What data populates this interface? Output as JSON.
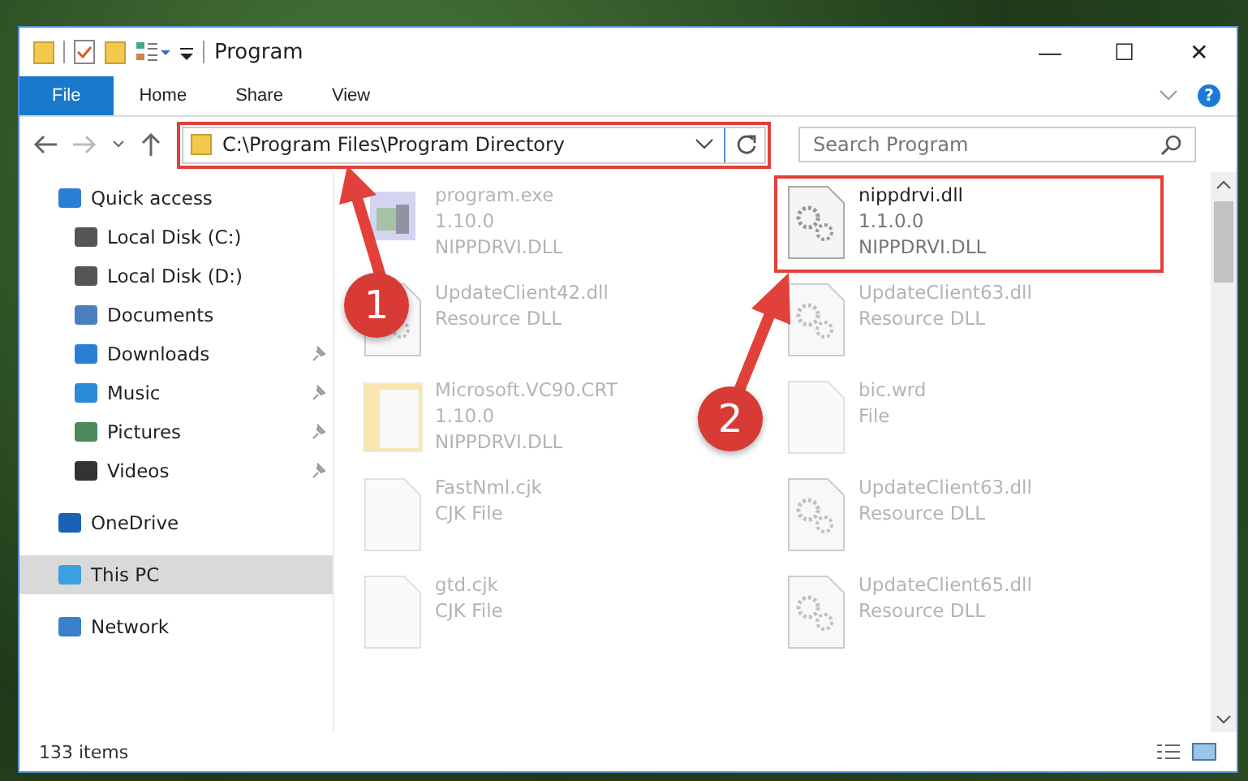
{
  "window": {
    "title": "Program",
    "controls": [
      "—",
      "☐",
      "✕"
    ]
  },
  "ribbon": {
    "tabs": [
      {
        "label": "File",
        "selected": true
      },
      {
        "label": "Home",
        "selected": false
      },
      {
        "label": "Share",
        "selected": false
      },
      {
        "label": "View",
        "selected": false
      }
    ],
    "help": "?"
  },
  "address_bar": {
    "path": "C:\\Program Files\\Program Directory",
    "highlighted": true
  },
  "search": {
    "placeholder": "Search Program"
  },
  "sidebar": {
    "items": [
      {
        "label": "Quick access",
        "pinned": false,
        "selected": false,
        "children": [
          {
            "label": "Local Disk (C:)",
            "pinned": false,
            "selected": false
          },
          {
            "label": "Local Disk (D:)",
            "pinned": false,
            "selected": false
          },
          {
            "label": "Documents",
            "pinned": false,
            "selected": false
          },
          {
            "label": "Downloads",
            "pinned": true,
            "selected": false
          },
          {
            "label": "Music",
            "pinned": true,
            "selected": false
          },
          {
            "label": "Pictures",
            "pinned": true,
            "selected": false
          },
          {
            "label": "Videos",
            "pinned": true,
            "selected": false
          }
        ]
      },
      {
        "label": "OneDrive",
        "pinned": false,
        "selected": false
      },
      {
        "label": "This PC",
        "pinned": false,
        "selected": true
      },
      {
        "label": "Network",
        "pinned": false,
        "selected": false
      }
    ]
  },
  "files": [
    {
      "name": "program.exe",
      "details": [
        "1.10.0",
        "NIPPDRVI.DLL"
      ],
      "kind": "exe",
      "blurred": true,
      "highlighted": false
    },
    {
      "name": "nippdrvi.dll",
      "details": [
        "1.1.0.0",
        "NIPPDRVI.DLL"
      ],
      "kind": "dll",
      "blurred": false,
      "highlighted": true
    },
    {
      "name": "UpdateClient42.dll",
      "details": [
        "Resource DLL"
      ],
      "kind": "dll",
      "blurred": true,
      "highlighted": false
    },
    {
      "name": "UpdateClient63.dll",
      "details": [
        "Resource DLL"
      ],
      "kind": "dll",
      "blurred": true,
      "highlighted": false
    },
    {
      "name": "Microsoft.VC90.CRT",
      "details": [
        "1.10.0",
        "NIPPDRVI.DLL"
      ],
      "kind": "folder",
      "blurred": true,
      "highlighted": false
    },
    {
      "name": "bic.wrd",
      "details": [
        "File"
      ],
      "kind": "file",
      "blurred": true,
      "highlighted": false
    },
    {
      "name": "FastNml.cjk",
      "details": [
        "CJK File"
      ],
      "kind": "file",
      "blurred": true,
      "highlighted": false
    },
    {
      "name": "UpdateClient63.dll",
      "details": [
        "Resource DLL"
      ],
      "kind": "dll",
      "blurred": true,
      "highlighted": false
    },
    {
      "name": "gtd.cjk",
      "details": [
        "CJK File"
      ],
      "kind": "file",
      "blurred": true,
      "highlighted": false
    },
    {
      "name": "UpdateClient65.dll",
      "details": [
        "Resource DLL"
      ],
      "kind": "dll",
      "blurred": true,
      "highlighted": false
    }
  ],
  "status_bar": {
    "count": "133 items"
  },
  "callouts": [
    {
      "number": "1"
    },
    {
      "number": "2"
    }
  ]
}
